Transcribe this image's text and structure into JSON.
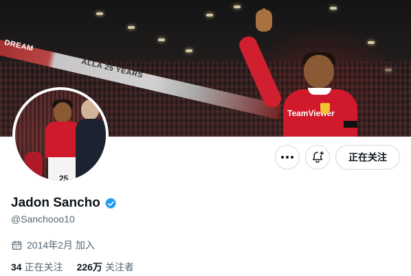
{
  "banner": {
    "stand_text_1": "DREAM",
    "stand_text_2": "ALLA 25 YEARS",
    "shirt_sponsor": "TeamViewer"
  },
  "avatar": {
    "shirt_number": "25"
  },
  "actions": {
    "more_icon": "more-horizontal-icon",
    "notify_icon": "bell-plus-icon",
    "following_label": "正在关注"
  },
  "profile": {
    "display_name": "Jadon Sancho",
    "verified_icon": "verified-badge-icon",
    "handle": "@Sanchooo10",
    "joined_icon": "calendar-icon",
    "joined_text": "2014年2月 加入",
    "following_count": "34",
    "following_label": "正在关注",
    "followers_count": "226万",
    "followers_label": "关注者"
  },
  "colors": {
    "verified_blue": "#1d9bf0",
    "secondary_text": "#536471",
    "border": "#cfd9de",
    "united_red": "#d0192a"
  }
}
